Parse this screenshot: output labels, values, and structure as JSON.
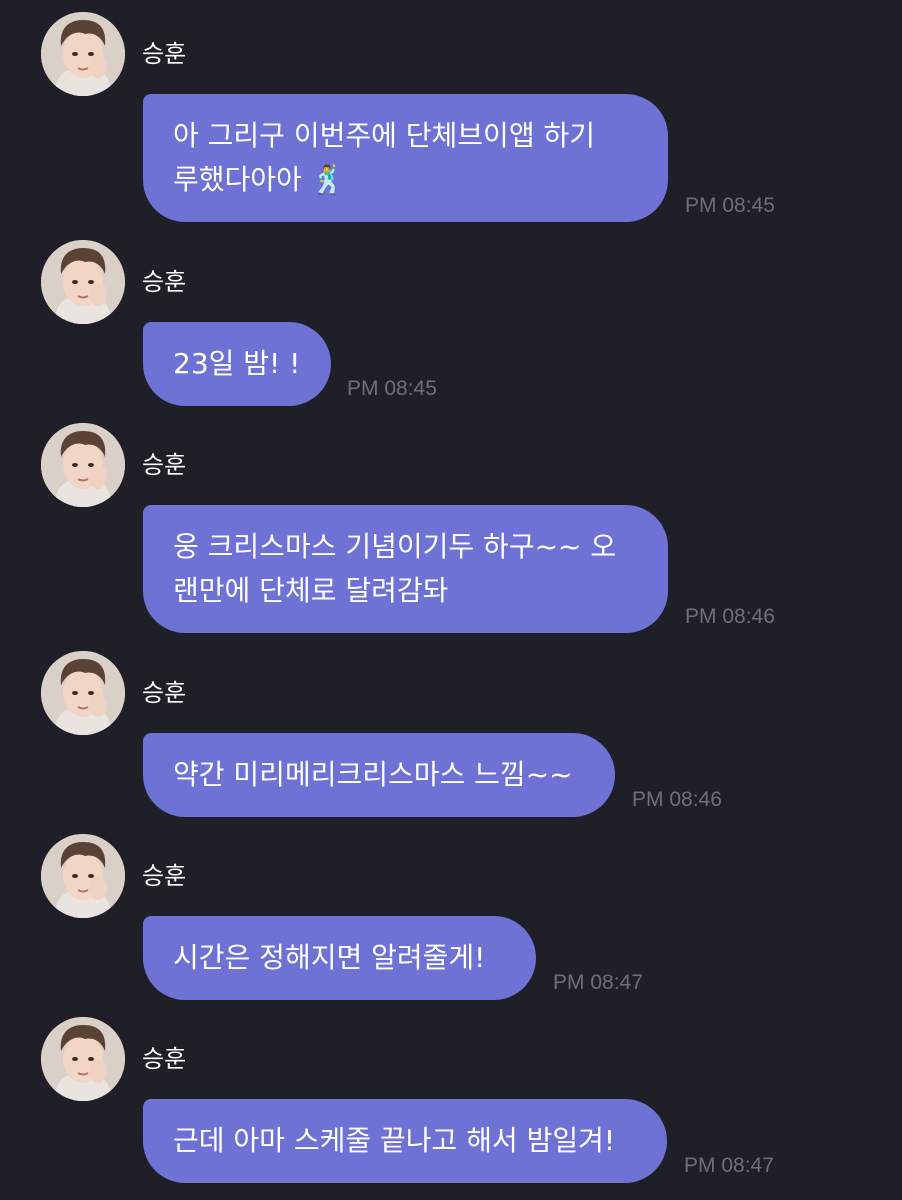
{
  "colors": {
    "background": "#1f1f27",
    "bubble": "#6e72d4",
    "text": "#ffffff",
    "timestamp": "#6f6f78"
  },
  "messages": [
    {
      "sender": "승훈",
      "lines": [
        "아 그리구 이번주에 단체브이앱 하기",
        "루했다아아 🕺"
      ],
      "time": "PM 08:45"
    },
    {
      "sender": "승훈",
      "lines": [
        "23일 밤! !"
      ],
      "time": "PM 08:45"
    },
    {
      "sender": "승훈",
      "lines": [
        "웅 크리스마스 기념이기두 하구~~ 오",
        "랜만에 단체로 달려감돠"
      ],
      "time": "PM 08:46"
    },
    {
      "sender": "승훈",
      "lines": [
        "약간 미리메리크리스마스 느낌~~"
      ],
      "time": "PM 08:46"
    },
    {
      "sender": "승훈",
      "lines": [
        "시간은 정해지면 알려줄게!"
      ],
      "time": "PM 08:47"
    },
    {
      "sender": "승훈",
      "lines": [
        "근데 아마 스케줄 끝나고 해서 밤일겨!"
      ],
      "time": "PM 08:47"
    }
  ]
}
